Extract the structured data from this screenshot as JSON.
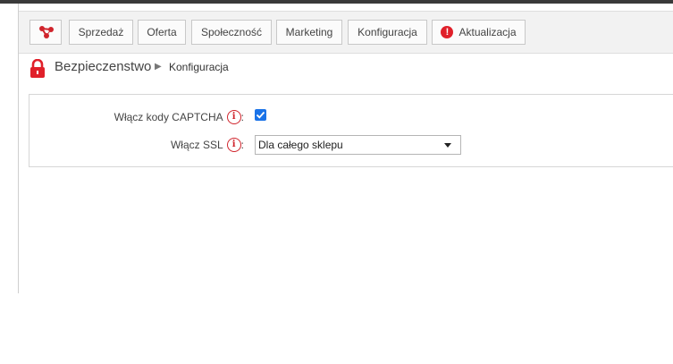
{
  "nav": {
    "home_icon": "network-share-icon",
    "items": [
      {
        "label": "Sprzedaż"
      },
      {
        "label": "Oferta"
      },
      {
        "label": "Społeczność"
      },
      {
        "label": "Marketing"
      },
      {
        "label": "Konfiguracja"
      },
      {
        "label": "Aktualizacja",
        "alert": "!"
      }
    ],
    "accent_color": "#e0202a"
  },
  "breadcrumb": {
    "icon": "lock-icon",
    "root": "Bezpieczenstwo",
    "separator": "▶",
    "current": "Konfiguracja"
  },
  "form": {
    "captcha": {
      "label": "Włącz kody CAPTCHA",
      "colon": ":",
      "info_icon": "i",
      "checked": true
    },
    "ssl": {
      "label": "Włącz SSL",
      "colon": ":",
      "info_icon": "i",
      "selected": "Dla całego sklepu"
    }
  }
}
